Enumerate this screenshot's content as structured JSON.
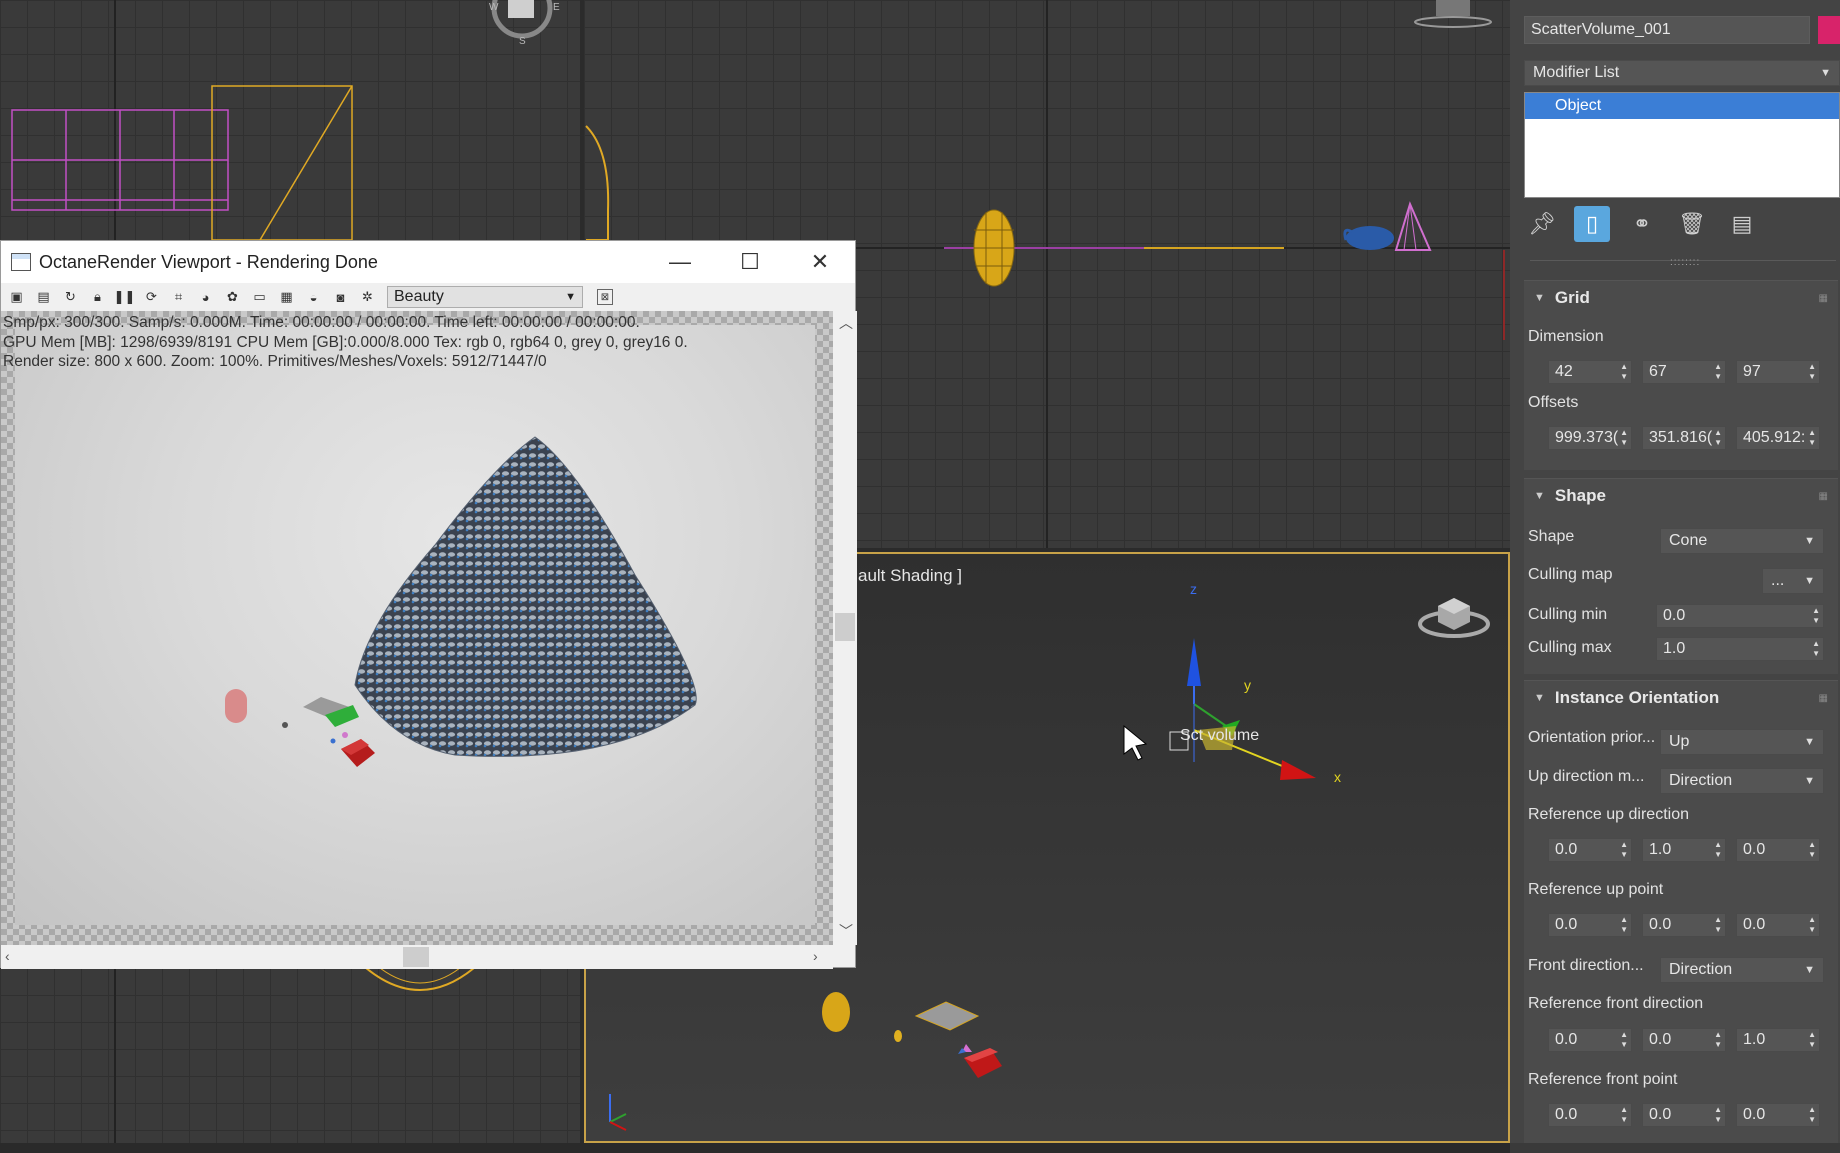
{
  "octane": {
    "title": "OctaneRender Viewport - Rendering Done",
    "pass": "Beauty",
    "stats": [
      "Smp/px: 300/300.  Samp/s: 0.000M.  Time: 00:00:00 / 00:00:00.  Time left: 00:00:00 / 00:00:00.",
      "GPU Mem [MB]: 1298/6939/8191  CPU Mem [GB]:0.000/8.000  Tex: rgb 0, rgb64 0, grey 0, grey16 0.",
      "Render size: 800 x 600.  Zoom: 100%.  Primitives/Meshes/Voxels: 5912/71447/0"
    ]
  },
  "viewport": {
    "persp_label": "ault Shading ]",
    "object_label": "Sct volume",
    "axis_x": "x",
    "axis_y": "y",
    "axis_z": "z"
  },
  "panel": {
    "object_name": "ScatterVolume_001",
    "object_color": "#d8236a",
    "modifier_list": "Modifier List",
    "stack_item": "Object",
    "grid": {
      "title": "Grid",
      "dimension_label": "Dimension",
      "dimension": [
        "42",
        "67",
        "97"
      ],
      "offsets_label": "Offsets",
      "offsets": [
        "999.373(",
        "351.816(",
        "405.912:"
      ]
    },
    "shape": {
      "title": "Shape",
      "shape_label": "Shape",
      "shape_value": "Cone",
      "culling_map_label": "Culling map",
      "culling_map_value": "...",
      "culling_min_label": "Culling min",
      "culling_min": "0.0",
      "culling_max_label": "Culling max",
      "culling_max": "1.0"
    },
    "orientation": {
      "title": "Instance Orientation",
      "priority_label": "Orientation prior...",
      "priority_value": "Up",
      "up_mode_label": "Up direction m...",
      "up_mode_value": "Direction",
      "ref_up_dir_label": "Reference up direction",
      "ref_up_dir": [
        "0.0",
        "1.0",
        "0.0"
      ],
      "ref_up_point_label": "Reference up point",
      "ref_up_point": [
        "0.0",
        "0.0",
        "0.0"
      ],
      "front_dir_label": "Front direction...",
      "front_dir_value": "Direction",
      "ref_front_dir_label": "Reference front direction",
      "ref_front_dir": [
        "0.0",
        "0.0",
        "1.0"
      ],
      "ref_front_point_label": "Reference front point",
      "ref_front_point": [
        "0.0",
        "0.0",
        "0.0"
      ]
    }
  }
}
